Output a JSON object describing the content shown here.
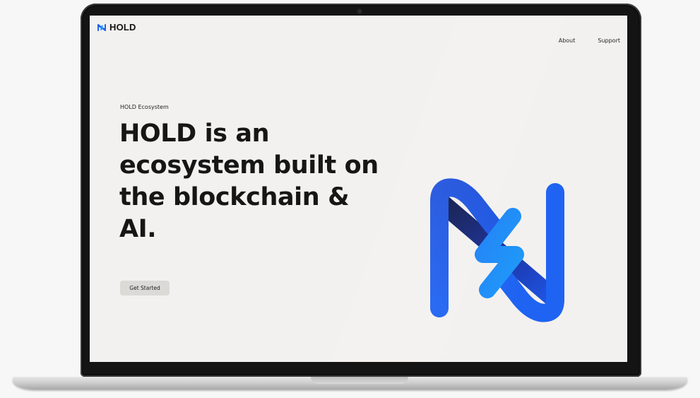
{
  "site": {
    "brand": "HOLD",
    "nav": [
      "About",
      "Support"
    ]
  },
  "hero": {
    "eyebrow": "HOLD Ecosystem",
    "headline": [
      "HOLD is an",
      "ecosystem built on",
      "the blockchain &",
      "AI."
    ],
    "cta_label": "Get Started"
  },
  "icons": {
    "brand_logo": "hold-logo-icon",
    "hero_mark": "hold-mark-icon"
  },
  "colors": {
    "brand_blue": "#1f63f2",
    "brand_light_blue": "#1e8ef7",
    "brand_dark": "#0d1f5c",
    "page_background": "#f3f1ef",
    "button_background": "#dcdad7"
  }
}
